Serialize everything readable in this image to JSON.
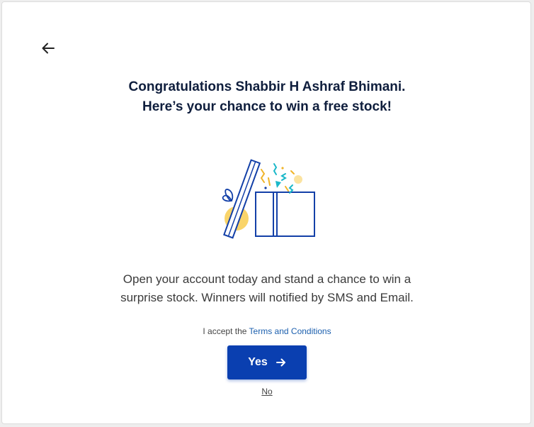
{
  "header": {
    "back_icon": "arrow-left-icon"
  },
  "title": {
    "line1": "Congratulations Shabbir H Ashraf Bhimani.",
    "line2": "Here’s your chance to win a free stock!"
  },
  "illustration": {
    "icon": "open-gift-box-icon",
    "colors": {
      "outline": "#1340a8",
      "accent_yellow": "#f7c948",
      "confetti_teal": "#1bb8c9"
    }
  },
  "description": {
    "line1": "Open your account today and stand a chance to win a",
    "line2": "surprise stock. Winners will notified by SMS and Email."
  },
  "terms": {
    "prefix": "I accept the ",
    "link_label": "Terms and Conditions"
  },
  "actions": {
    "yes_label": "Yes",
    "yes_icon": "arrow-right-icon",
    "no_label": "No"
  },
  "colors": {
    "primary": "#0a3fb0",
    "link": "#1b5fae",
    "heading": "#0f1e3d"
  }
}
